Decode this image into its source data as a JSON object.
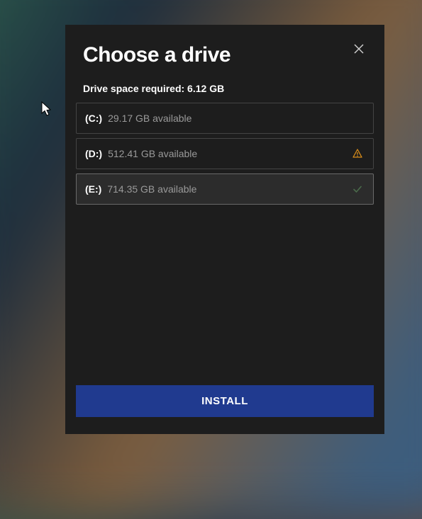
{
  "dialog": {
    "title": "Choose a drive",
    "space_required_label": "Drive space required: 6.12 GB",
    "install_button": "INSTALL"
  },
  "drives": [
    {
      "letter": "(C:)",
      "available": "29.17 GB available",
      "status": "none",
      "selected": false
    },
    {
      "letter": "(D:)",
      "available": "512.41 GB available",
      "status": "warning",
      "selected": false
    },
    {
      "letter": "(E:)",
      "available": "714.35 GB available",
      "status": "check",
      "selected": true
    }
  ]
}
